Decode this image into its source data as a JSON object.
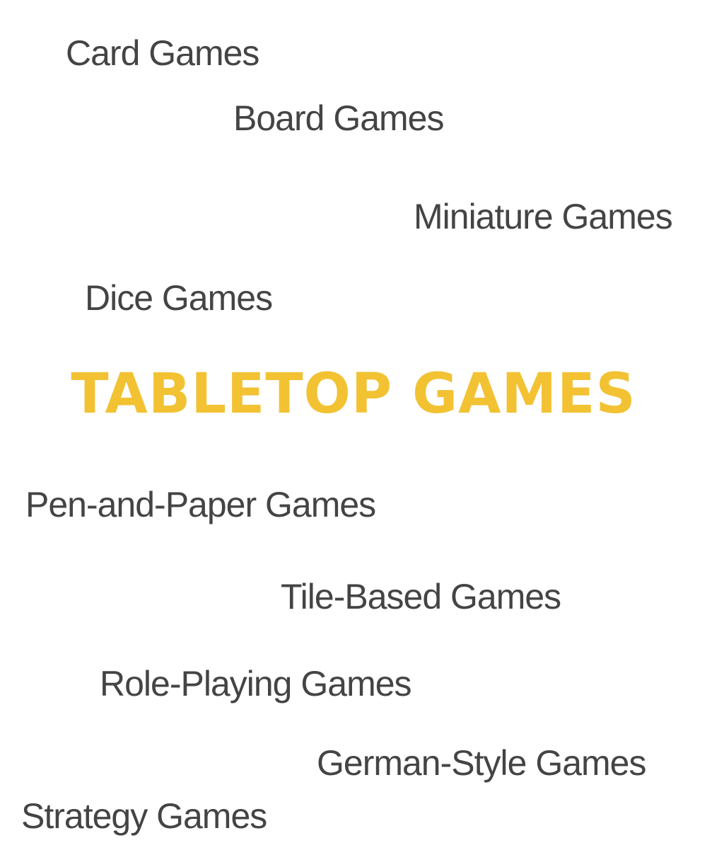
{
  "title": "TABLETOP GAMES",
  "colors": {
    "title": "#f2c233",
    "term": "#444444",
    "background": "#ffffff"
  },
  "terms": [
    "Card Games",
    "Board Games",
    "Miniature Games",
    "Dice Games",
    "Pen-and-Paper Games",
    "Tile-Based Games",
    "Role-Playing Games",
    "German-Style Games",
    "Strategy Games"
  ]
}
